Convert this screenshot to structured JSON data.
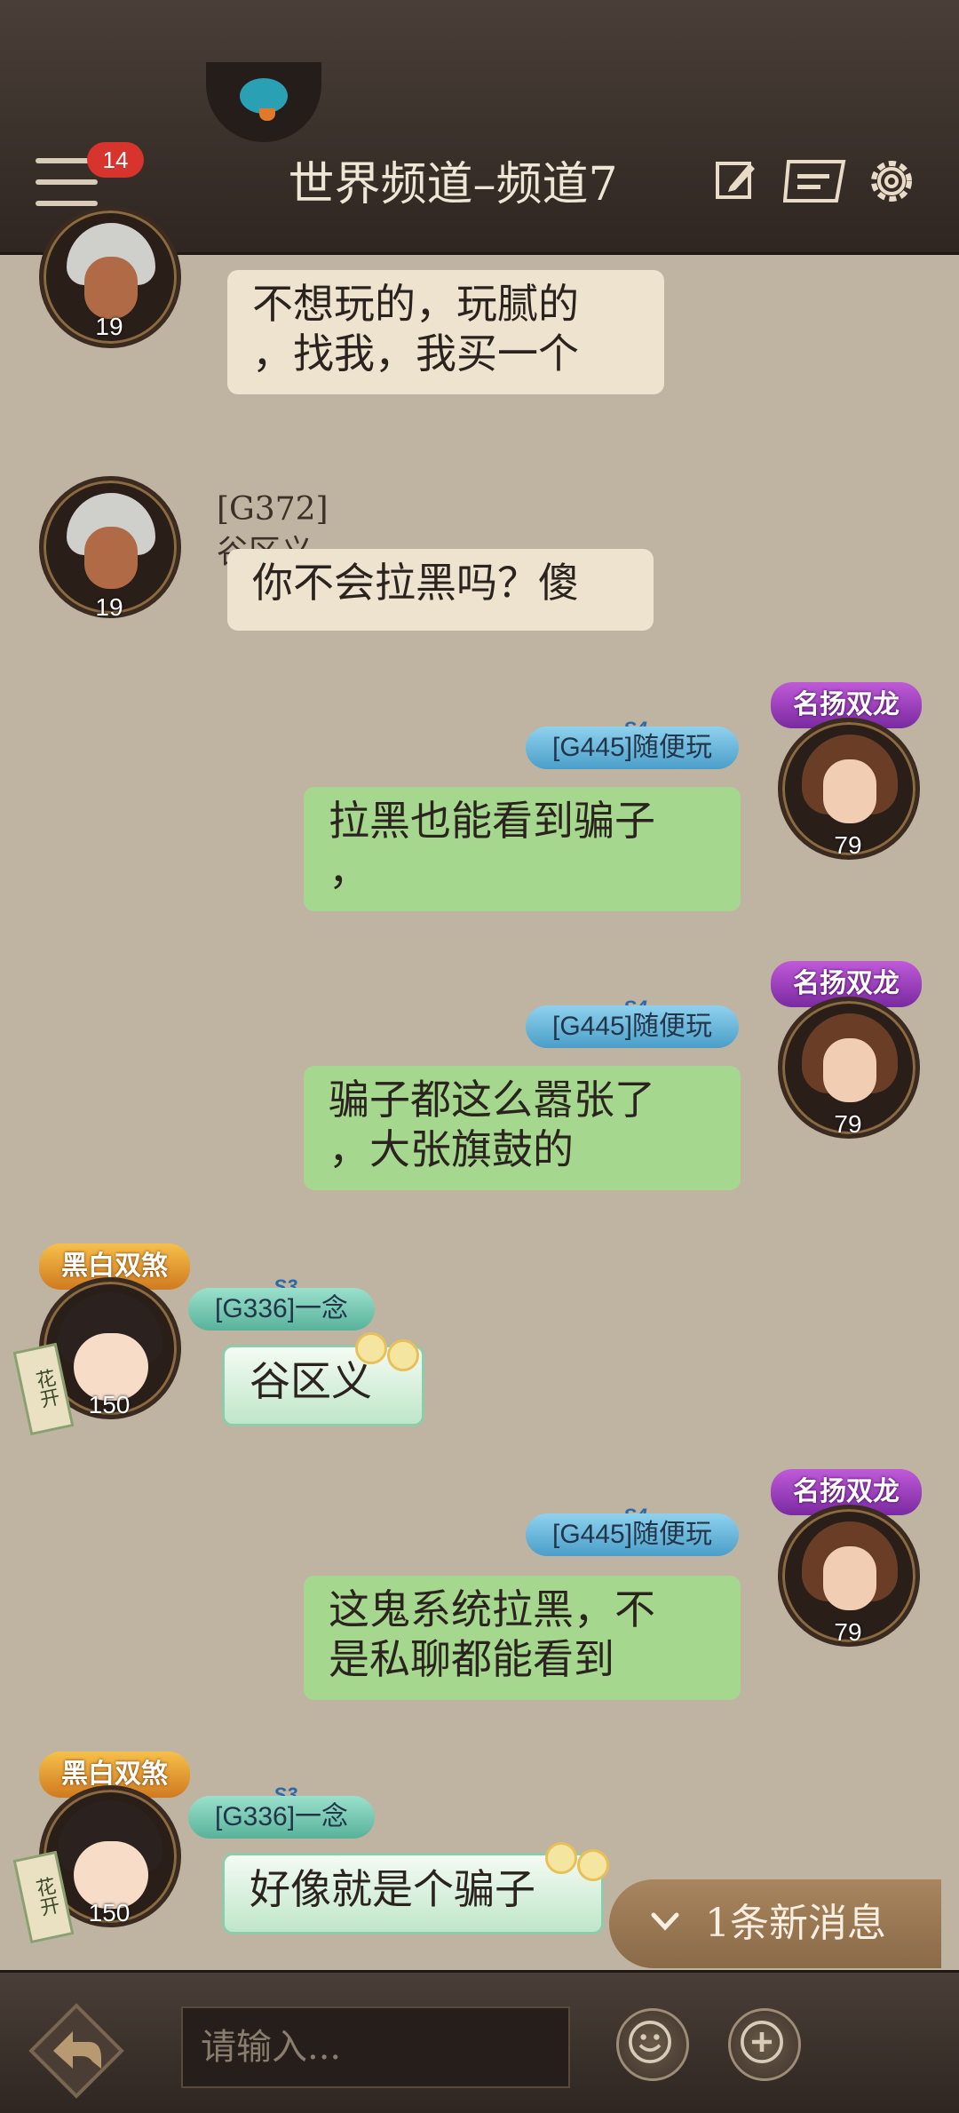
{
  "header": {
    "title": "世界频道–频道7",
    "unread_badge": "14",
    "icons": [
      "menu-icon",
      "edit-icon",
      "note-icon",
      "gear-icon"
    ]
  },
  "messages": [
    {
      "side": "left",
      "sender": "",
      "level": "19",
      "text": "不想玩的，玩腻的\n，找我，我买一个"
    },
    {
      "side": "left",
      "sender": "[G372]谷区义",
      "level": "19",
      "text": "你不会拉黑吗？傻"
    },
    {
      "side": "right",
      "sender": "[G445]随便玩",
      "season": "S4",
      "title_badge": "名扬双龙",
      "level": "79",
      "text": "拉黑也能看到骗子\n，"
    },
    {
      "side": "right",
      "sender": "[G445]随便玩",
      "season": "S4",
      "title_badge": "名扬双龙",
      "level": "79",
      "text": "骗子都这么嚣张了\n，大张旗鼓的"
    },
    {
      "side": "left",
      "sender": "[G336]一念",
      "season": "S3",
      "title_badge": "黑白双煞",
      "side_tag": "花开",
      "level": "150",
      "text": "谷区义"
    },
    {
      "side": "right",
      "sender": "[G445]随便玩",
      "season": "S4",
      "title_badge": "名扬双龙",
      "level": "79",
      "text": "这鬼系统拉黑，不\n是私聊都能看到"
    },
    {
      "side": "left",
      "sender": "[G336]一念",
      "season": "S3",
      "title_badge": "黑白双煞",
      "side_tag": "花开",
      "level": "150",
      "text": "好像就是个骗子"
    }
  ],
  "new_messages": {
    "label": "1条新消息"
  },
  "input": {
    "placeholder": "请输入..."
  },
  "colors": {
    "bubble_mine": "#a5d78f",
    "bubble_other": "#eee3cf",
    "background": "#bfb3a1"
  }
}
